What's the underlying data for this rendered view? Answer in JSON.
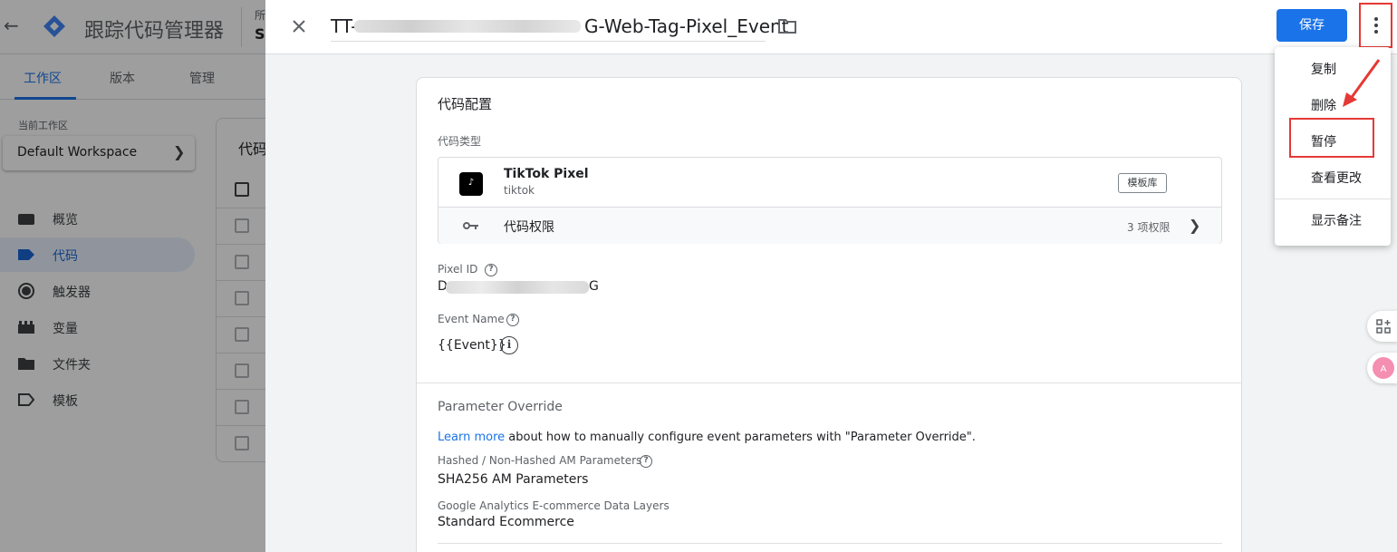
{
  "app": {
    "title": "跟踪代码管理器",
    "account_label": "所",
    "account_value": "Se"
  },
  "top_tabs": [
    {
      "label": "工作区",
      "active": true
    },
    {
      "label": "版本",
      "active": false
    },
    {
      "label": "管理",
      "active": false
    }
  ],
  "workspace": {
    "label": "当前工作区",
    "name": "Default Workspace"
  },
  "nav": [
    {
      "label": "概览",
      "icon": "overview-icon",
      "active": false
    },
    {
      "label": "代码",
      "icon": "tag-icon",
      "active": true
    },
    {
      "label": "触发器",
      "icon": "trigger-icon",
      "active": false
    },
    {
      "label": "变量",
      "icon": "variable-icon",
      "active": false
    },
    {
      "label": "文件夹",
      "icon": "folder-icon",
      "active": false
    },
    {
      "label": "模板",
      "icon": "template-icon",
      "active": false
    }
  ],
  "bg_list": {
    "title": "代码"
  },
  "editor": {
    "tag_name_prefix": "TT-",
    "tag_name_suffix": "G-Web-Tag-Pixel_Event",
    "save_label": "保存",
    "card_title": "代码配置",
    "tag_type_label": "代码类型",
    "tag_type": {
      "name": "TikTok Pixel",
      "vendor": "tiktok",
      "logo_text": "TikTok",
      "gallery_label": "模板库"
    },
    "permissions": {
      "label": "代码权限",
      "count": "3 项权限"
    },
    "fields": {
      "pixel_id_label": "Pixel ID",
      "pixel_id_prefix": "D",
      "pixel_id_suffix": "G",
      "event_name_label": "Event Name",
      "event_name_value": "{{Event}}"
    },
    "override": {
      "title": "Parameter Override",
      "learn_more": "Learn more",
      "learn_text": " about how to manually configure event parameters with \"Parameter Override\".",
      "hashed_label": "Hashed / Non-Hashed AM Parameters",
      "hashed_value": "SHA256 AM Parameters",
      "ga_label": "Google Analytics E-commerce Data Layers",
      "ga_value": "Standard Ecommerce"
    }
  },
  "menu": {
    "items": [
      {
        "label": "复制"
      },
      {
        "label": "删除"
      },
      {
        "label": "暂停"
      },
      {
        "label": "查看更改"
      },
      {
        "label": "显示备注"
      }
    ]
  },
  "colors": {
    "accent": "#1a73e8",
    "highlight": "#e53935"
  }
}
